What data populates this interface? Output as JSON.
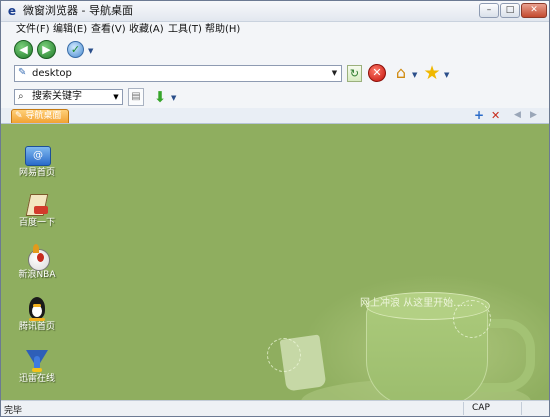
{
  "window": {
    "title": "微窗浏览器 - 导航桌面",
    "app_icon": "e",
    "controls": {
      "minimize": "–",
      "maximize": "□",
      "close": "✕"
    }
  },
  "menu": [
    {
      "label": "文件(F)"
    },
    {
      "label": "编辑(E)"
    },
    {
      "label": "查看(V)"
    },
    {
      "label": "收藏(A)"
    },
    {
      "label": "工具(T)"
    },
    {
      "label": "帮助(H)"
    }
  ],
  "nav": {
    "back_icon": "arrow-left-icon",
    "forward_icon": "arrow-right-icon",
    "history_icon": "history-icon"
  },
  "address": {
    "value": "desktop",
    "icon": "page-icon"
  },
  "search": {
    "value": "搜索关键字",
    "icon": "search-icon"
  },
  "tab": {
    "label": "导航桌面"
  },
  "tab_controls": {
    "add": "+",
    "close": "✕",
    "prev": "◀",
    "next": "▶"
  },
  "desktop": {
    "slogan": "网上冲浪 从这里开始……",
    "icons": [
      {
        "label": "网易首页",
        "icon": "netease-icon"
      },
      {
        "label": "百度一下",
        "icon": "baidu-icon"
      },
      {
        "label": "新浪NBA",
        "icon": "sina-nba-icon"
      },
      {
        "label": "腾讯首页",
        "icon": "tencent-penguin-icon"
      },
      {
        "label": "迅雷在线",
        "icon": "xunlei-bird-icon"
      }
    ]
  },
  "status": {
    "text": "完毕",
    "cap": "CAP"
  },
  "colors": {
    "desktop_bg": "#8fae5f",
    "tab_active": "#f1a233",
    "accent_blue": "#2a6bc9"
  }
}
